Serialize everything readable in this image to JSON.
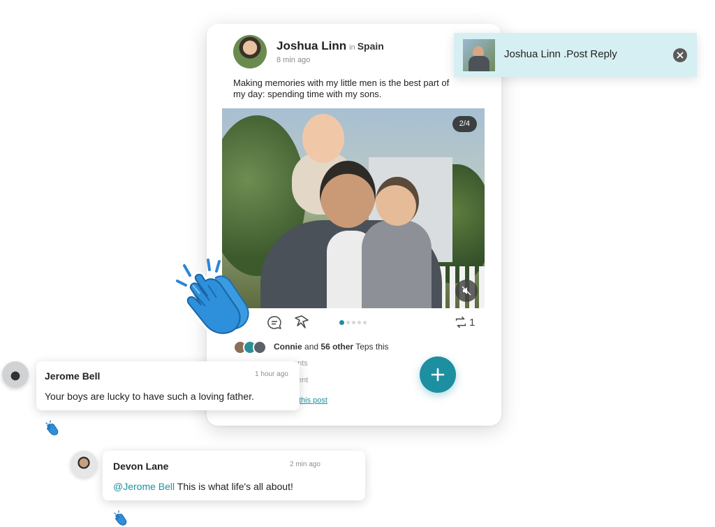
{
  "post": {
    "author": "Joshua Linn",
    "in_word": "in",
    "location": "Spain",
    "time": "8 min ago",
    "caption": "Making memories with my little men is the best part of my day: spending time with my sons.",
    "photo_counter": "2/4",
    "repost_count": "1",
    "likes": {
      "name": "Connie",
      "connector": "and",
      "others": "56 other",
      "suffix": "Teps this"
    },
    "faded_comments": "ents",
    "faded_text": "ent",
    "faded_link": "this post",
    "carousel": {
      "total": 5,
      "active_index": 0
    }
  },
  "toast": {
    "text": "Joshua Linn .Post Reply"
  },
  "comments": [
    {
      "name": "Jerome Bell",
      "time": "1 hour ago",
      "text": "Your boys are lucky to have such a loving father."
    },
    {
      "name": "Devon Lane",
      "time": "2 min ago",
      "mention": "@Jerome Bell",
      "text": "This is what life's all about!"
    }
  ],
  "colors": {
    "accent": "#1d8fa0",
    "toast_bg": "#d6eff2",
    "clap_blue": "#2a86d6"
  },
  "icons": [
    "comment-icon",
    "share-icon",
    "repost-icon",
    "mute-icon",
    "close-icon",
    "plus-icon",
    "clap-icon"
  ]
}
